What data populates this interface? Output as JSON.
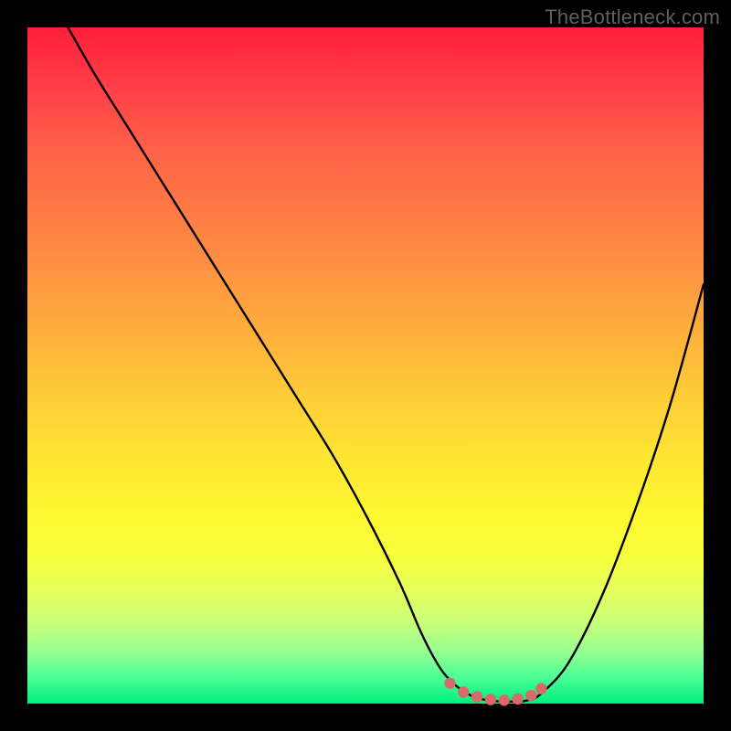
{
  "watermark": "TheBottleneck.com",
  "colors": {
    "background": "#000000",
    "curve_stroke": "#000000",
    "marker_fill": "#d86a6a",
    "gradient_top": "#ff1f3a",
    "gradient_bottom": "#00f07a"
  },
  "chart_data": {
    "type": "line",
    "title": "",
    "xlabel": "",
    "ylabel": "",
    "xlim": [
      0,
      100
    ],
    "ylim": [
      0,
      100
    ],
    "grid": false,
    "legend": false,
    "series": [
      {
        "name": "curve",
        "x": [
          6,
          10,
          15,
          20,
          25,
          30,
          35,
          40,
          45,
          50,
          55,
          58,
          60,
          62,
          65,
          68,
          72,
          74,
          76,
          80,
          85,
          90,
          95,
          100
        ],
        "y": [
          100,
          93,
          85,
          77,
          69,
          61,
          53,
          45,
          37,
          28,
          18,
          11,
          7,
          4,
          1.5,
          0.5,
          0.3,
          0.5,
          1.5,
          6,
          16,
          29,
          44,
          62
        ]
      }
    ],
    "markers": [
      {
        "x": 62.5,
        "y": 3.0
      },
      {
        "x": 64.5,
        "y": 1.7
      },
      {
        "x": 66.5,
        "y": 1.0
      },
      {
        "x": 68.5,
        "y": 0.6
      },
      {
        "x": 70.5,
        "y": 0.5
      },
      {
        "x": 72.5,
        "y": 0.7
      },
      {
        "x": 74.5,
        "y": 1.2
      },
      {
        "x": 76.0,
        "y": 2.2
      }
    ]
  }
}
